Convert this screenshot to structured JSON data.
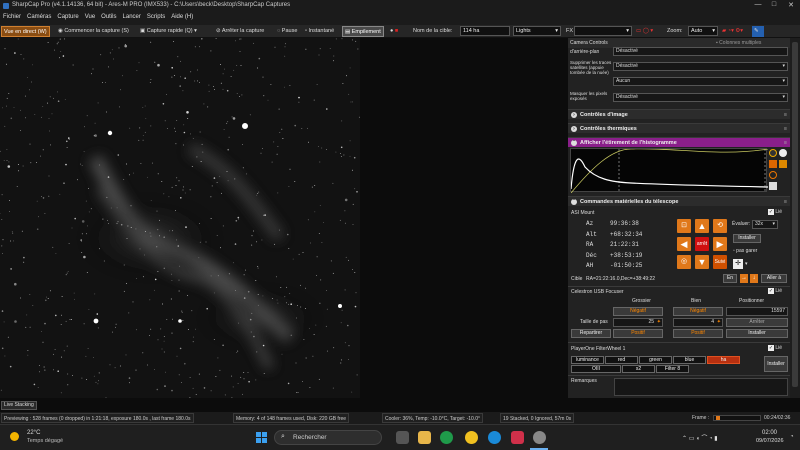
{
  "titlebar": {
    "title": "SharpCap Pro (v4.1.14136, 64 bit) - Ares-M PRO (IMX533) - C:\\Users\\beck\\Desktop\\SharpCap Captures",
    "minimize": "—",
    "maximize": "□",
    "close": "✕"
  },
  "menu": [
    "Fichier",
    "Caméras",
    "Capture",
    "Vue",
    "Outils",
    "Lancer",
    "Scripts",
    "Aide (H)"
  ],
  "toolbar": {
    "live": "Vue en direct (W)",
    "start_capture": "Commencer la capture (S)",
    "quick_capture": "Capture rapide (Q)",
    "stop": "Arrêter la capture",
    "pause": "Pause",
    "snapshot": "Instantané",
    "stacking": "Empilement",
    "target_label": "Nom de la cible:",
    "target_value": "114 ha",
    "frame_type": "Lights",
    "fx": "FX",
    "zoom_label": "Zoom:",
    "zoom_value": "Auto"
  },
  "camera_controls": {
    "title": "Camera Controls",
    "multi": "Colonnes multiples",
    "bg_sub": "d'arrière-plan",
    "bg_sub_val": "Désactivé",
    "sat_label": "Supprimer les traces satellites (appuie tombée de la nuée)",
    "sat_val": "Désactivé",
    "row3_label": "Correction des pixels chauds",
    "row3_val": "Aucun",
    "hot_label": "Masquer les pixels exposés",
    "hot_val": "Désactivé"
  },
  "sections": {
    "image": "Contrôles d'image",
    "thermal": "Contrôles thermiques",
    "histogram": "Afficher l'étirement de l'histogramme",
    "telescope": "Commandes matérielles du télescope"
  },
  "mount": {
    "name": "ASI Mount",
    "linked": "Lié",
    "az_label": "Az",
    "az": "99:36:38",
    "alt_label": "Alt",
    "alt": "+68:32:34",
    "ra_label": "RA",
    "ra": "21:22:31",
    "dec_label": "Déc",
    "dec": "+38:53:19",
    "ah_label": "AH",
    "ah": "-01:50:25",
    "speed_label": "Évaluer:",
    "speed": "32x",
    "install": "Installer",
    "center": "arrêt",
    "track": "Suivi",
    "parking": "pas garer",
    "target_label": "Cible",
    "target": "RA=21:22:16.0,Dec=+38:49:22",
    "goto": "Aller à",
    "en": "En"
  },
  "focuser": {
    "name": "Celestron USB Focuser",
    "linked": "Lié",
    "coarse": "Grossier",
    "fine": "Bien",
    "position": "Positionner",
    "neg": "Négatif",
    "pos": "Positif",
    "step_label": "Taille de pas",
    "coarse_step": "25",
    "fine_step": "4",
    "position_val": "15597",
    "stop": "Arrêter",
    "repartir": "Repartirer",
    "install": "Installer"
  },
  "filterwheel": {
    "name": "PlayerOne FilterWheel 1",
    "linked": "Lié",
    "filters": [
      "luminance",
      "red",
      "green",
      "blue",
      "ha",
      "OIII",
      "s2",
      "Filter 8"
    ],
    "install": "Installer",
    "remarks": "Remarques"
  },
  "live_stacking": "Live Stacking",
  "status": {
    "previewing": "Previewing : 528 frames (0 dropped) in 1:21:18, exposure 180.0s , last frame 180.0s",
    "memory": "Memory: 4 of 148 frames used, Disk: 220 GB free",
    "cooler": "Cooler: 36%, Temp: -10.0°C, Target: -10.0°",
    "stacked": "19 Stacked, 0 Ignored, 57m 0s",
    "frame": "Frame :",
    "time": "00:24/02:36"
  },
  "taskbar": {
    "temp": "22°C",
    "weather": "Temps dégagé",
    "search": "Rechercher",
    "clock": "02:00",
    "date": "09/07/2026"
  }
}
